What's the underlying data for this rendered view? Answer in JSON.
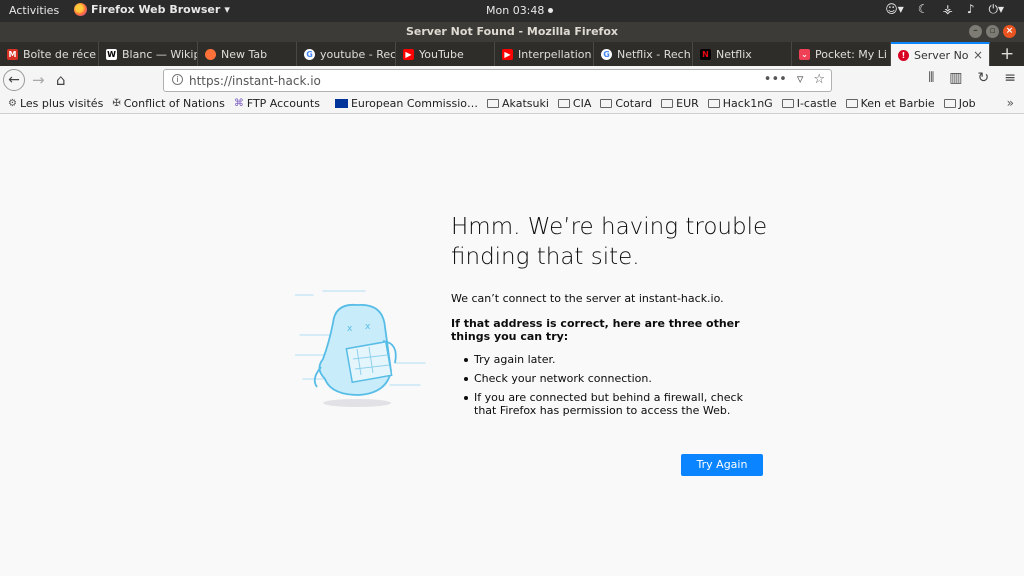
{
  "topbar": {
    "activities": "Activities",
    "app_menu": "Firefox Web Browser",
    "clock": "Mon 03:48"
  },
  "window": {
    "title": "Server Not Found - Mozilla Firefox"
  },
  "tabs": [
    {
      "label": "Boîte de réce",
      "icon": "gmail-icon",
      "color": "#d93025"
    },
    {
      "label": "Blanc — Wikip",
      "icon": "wikipedia-icon",
      "color": "#ffffff"
    },
    {
      "label": "New Tab",
      "icon": "firefox-icon",
      "color": "#ff7139"
    },
    {
      "label": "youtube - Rec",
      "icon": "google-icon",
      "color": "#4285f4"
    },
    {
      "label": "YouTube",
      "icon": "youtube-icon",
      "color": "#ff0000"
    },
    {
      "label": "Interpellation",
      "icon": "youtube-icon",
      "color": "#ff0000"
    },
    {
      "label": "Netflix - Rech",
      "icon": "google-icon",
      "color": "#4285f4"
    },
    {
      "label": "Netflix",
      "icon": "netflix-icon",
      "color": "#e50914"
    },
    {
      "label": "Pocket: My Li",
      "icon": "pocket-icon",
      "color": "#ef4056"
    },
    {
      "label": "Server Not",
      "icon": "error-icon",
      "color": "#d70022"
    }
  ],
  "navbar": {
    "url": "https://instant-hack.io"
  },
  "bookmarks": [
    {
      "label": "Les plus visités",
      "icon": "gear-icon"
    },
    {
      "label": "Conflict of Nations",
      "icon": "cross-icon"
    },
    {
      "label": "FTP Accounts",
      "icon": "ftp-icon"
    },
    {
      "label": "European Commissio…",
      "icon": "eu-flag-icon"
    },
    {
      "label": "Akatsuki",
      "icon": "folder-icon"
    },
    {
      "label": "CIA",
      "icon": "folder-icon"
    },
    {
      "label": "Cotard",
      "icon": "folder-icon"
    },
    {
      "label": "EUR",
      "icon": "folder-icon"
    },
    {
      "label": "Hack1nG",
      "icon": "folder-icon"
    },
    {
      "label": "I-castle",
      "icon": "folder-icon"
    },
    {
      "label": "Ken et Barbie",
      "icon": "folder-icon"
    },
    {
      "label": "Job",
      "icon": "folder-icon"
    }
  ],
  "error": {
    "title": "Hmm. We’re having trouble finding that site.",
    "description": "We can’t connect to the server at instant-hack.io.",
    "suggestions_heading": "If that address is correct, here are three other things you can try:",
    "suggestions": [
      "Try again later.",
      "Check your network connection.",
      "If you are connected but behind a firewall, check that Firefox has permission to access the Web."
    ],
    "try_again": "Try Again"
  },
  "colors": {
    "accent": "#0a84ff",
    "page_bg": "#f9f9fa",
    "topbar_bg": "#2b2b2b"
  }
}
